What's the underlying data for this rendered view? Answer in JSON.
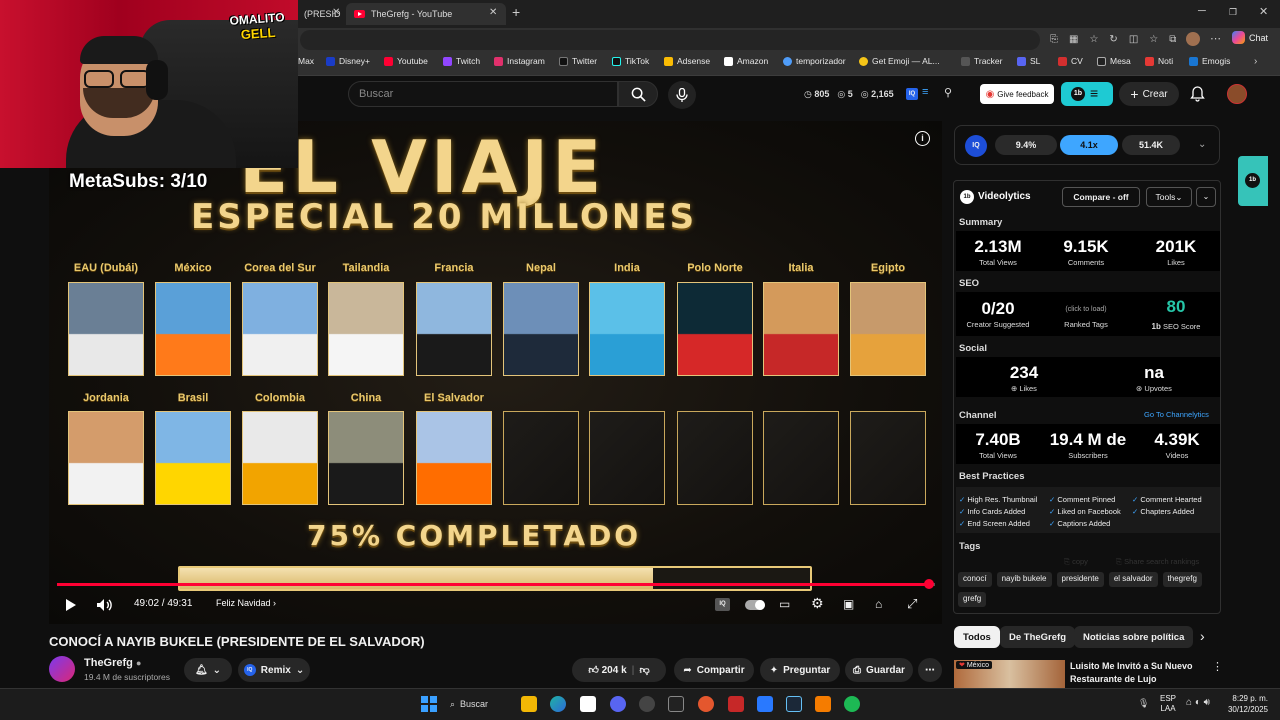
{
  "browser": {
    "tabs": [
      {
        "label": "(PRESID"
      },
      {
        "label": "TheGrefg - YouTube"
      }
    ],
    "bookmarks": [
      "Max",
      "Disney+",
      "Youtube",
      "Twitch",
      "Instagram",
      "Twitter",
      "TikTok",
      "Adsense",
      "Amazon",
      "temporizador",
      "Get Emoji — AL...",
      "Tracker",
      "SL",
      "CV",
      "Mesa",
      "Noti",
      "Emogis"
    ],
    "chat_label": "Chat"
  },
  "yt": {
    "search_placeholder": "Buscar",
    "stats": {
      "a": "805",
      "b": "5",
      "c": "2,165"
    },
    "feedback_label": "Give feedback",
    "create_label": "Crear"
  },
  "overlay": {
    "channel_logo_line1": "OMALITO",
    "channel_logo_line2": "GELL",
    "metasubs": "MetaSubs: 3/10"
  },
  "thumbnail": {
    "title_line1": "EL VIAJE",
    "title_line2": "ESPECIAL 20 MILLONES",
    "row1": [
      "EAU (Dubái)",
      "México",
      "Corea del Sur",
      "Tailandia",
      "Francia",
      "Nepal",
      "India",
      "Polo Norte",
      "Italia",
      "Egipto"
    ],
    "row2": [
      "Jordania",
      "Brasil",
      "Colombia",
      "China",
      "El Salvador"
    ],
    "completed_text": "75% COMPLETADO",
    "progress_fraction": 0.75
  },
  "player": {
    "time": "49:02 / 49:31",
    "chapter": "Feliz Navidad",
    "played_fraction": 0.993
  },
  "video": {
    "title": "CONOCÍ A NAYIB BUKELE (PRESIDENTE DE EL SALVADOR)",
    "channel": "TheGrefg",
    "subs": "19.4 M de suscriptores",
    "remix": "Remix",
    "likes": "204 k",
    "share": "Compartir",
    "ask": "Preguntar",
    "save": "Guardar"
  },
  "vidiq": {
    "top_stats": [
      "9.4%",
      "4.1x",
      "51.4K"
    ],
    "brand": "Videolytics",
    "compare": "Compare - off",
    "tools": "Tools",
    "summary_label": "Summary",
    "summary": [
      {
        "value": "2.13M",
        "label": "Total Views"
      },
      {
        "value": "9.15K",
        "label": "Comments"
      },
      {
        "value": "201K",
        "label": "Likes"
      }
    ],
    "seo_label": "SEO",
    "seo_creator": {
      "value": "0/20",
      "label": "Creator Suggested"
    },
    "seo_ranked": {
      "value": "(click to load)",
      "label": "Ranked Tags"
    },
    "seo_score": {
      "value": "80",
      "label": "SEO Score"
    },
    "social_label": "Social",
    "social_likes": {
      "value": "234",
      "label": "Likes"
    },
    "social_upvotes": {
      "value": "na",
      "label": "Upvotes"
    },
    "channel_label": "Channel",
    "channel_link": "Go To Channelytics",
    "channel": [
      {
        "value": "7.40B",
        "label": "Total Views"
      },
      {
        "value": "19.4 M de",
        "label": "Subscribers"
      },
      {
        "value": "4.39K",
        "label": "Videos"
      }
    ],
    "bp_label": "Best Practices",
    "best_practices": [
      "High Res. Thumbnail",
      "Comment Pinned",
      "Comment Hearted",
      "Info Cards Added",
      "Liked on Facebook",
      "Chapters Added",
      "End Screen Added",
      "Captions Added"
    ],
    "tags_label": "Tags",
    "tags_copy": "copy",
    "tags_share": "Share search rankings",
    "tags": [
      "conocí",
      "nayib bukele",
      "presidente",
      "el salvador",
      "thegrefg",
      "grefg"
    ]
  },
  "chips": [
    "Todos",
    "De TheGrefg",
    "Noticias sobre política"
  ],
  "rec": {
    "badge": "México",
    "title": "Luisito Me Invitó a Su Nuevo Restaurante de Lujo"
  },
  "taskbar": {
    "search": "Buscar",
    "lang1": "ESP",
    "lang2": "LAA",
    "time": "8:29 p. m.",
    "date": "30/12/2025"
  }
}
